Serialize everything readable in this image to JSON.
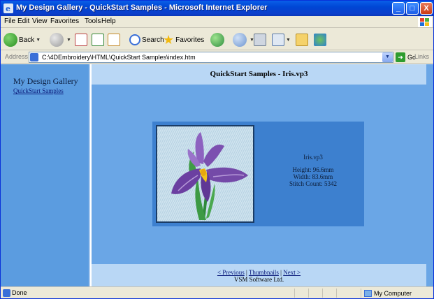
{
  "window": {
    "title": "My Design Gallery - QuickStart Samples - Microsoft Internet Explorer",
    "minimize": "_",
    "maximize": "□",
    "close": "X"
  },
  "menu": [
    "File",
    "Edit",
    "View",
    "Favorites",
    "Tools",
    "Help"
  ],
  "toolbar": {
    "back": "Back",
    "search": "Search",
    "favorites": "Favorites"
  },
  "address": {
    "label": "Address",
    "url": "C:\\4DEmbroidery\\HTML\\QuickStart Samples\\index.htm",
    "go": "Go",
    "links": "Links"
  },
  "sidebar": {
    "title": "My Design Gallery",
    "link": "QuickStart Samples"
  },
  "main": {
    "header": "QuickStart Samples - Iris.vp3"
  },
  "design": {
    "filename": "Iris.vp3",
    "height": "Height: 96.6mm",
    "width": "Width: 83.6mm",
    "stitch_count": "Stitch Count: 5342"
  },
  "footer": {
    "previous": "< Previous",
    "sep1": " | ",
    "thumbnails": "Thumbnails",
    "sep2": " | ",
    "next": "Next >",
    "company": "VSM Software Ltd."
  },
  "status": {
    "text": "Done",
    "zone": "My Computer"
  },
  "colors": {
    "sidebar_bg": "#5b9ce0",
    "main_bg": "#6aa6e6",
    "header_bg": "#b9d7f5",
    "panel_bg": "#3d80cf",
    "iris_petal": "#7b4fae"
  }
}
